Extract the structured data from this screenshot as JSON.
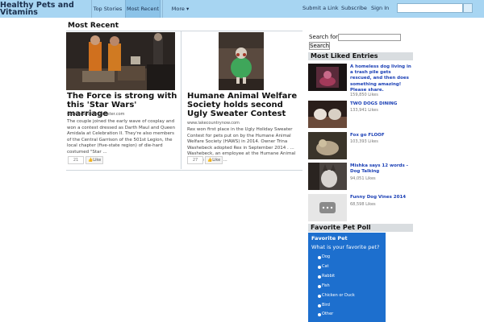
{
  "site": {
    "title_line1": "Healthy Pets and",
    "title_line2": "Vitamins"
  },
  "nav": {
    "items": [
      {
        "label": "Top Stories"
      },
      {
        "label": "Most Recent"
      },
      {
        "label": "More ▾"
      }
    ],
    "right_links": [
      "Submit a Link",
      "Subscribe",
      "Sign In"
    ]
  },
  "main": {
    "section_title": "Most Recent",
    "articles": [
      {
        "headline": "The Force is strong with this 'Star Wars' marriage",
        "source": "www.desmoinesregister.com",
        "excerpt": "The couple joined the early wave of cosplay and won a contest dressed as Darth Maul and Queen Amidala at Celebration II. They're also members of the Central Garrison of the 501st Legion, the local chapter (five-state region) of die-hard costumed \"Star ...",
        "count": "21",
        "like_label": "Like"
      },
      {
        "headline": "Humane Animal Welfare Society holds second Ugly Sweater Contest",
        "source": "www.lakecountrynow.com",
        "excerpt": "Rex won first place in the Ugly Holiday Sweater Contest for pets put on by the Humane Animal Welfare Society (HAWS) in 2014. Owner Trina Washebeck adopted Rex in September 2014 . ... Washebeck, an employee at the Humane Animal Welfare Society ...",
        "count": "27",
        "like_label": "Like"
      }
    ]
  },
  "sidebar": {
    "search_label": "Search for:",
    "search_button": "Search",
    "most_liked_title": "Most Liked Entries",
    "entries": [
      {
        "title": "A homeless dog living in a trash pile gets rescued, and then does something amazing! Please share.",
        "likes": "159,850 Likes"
      },
      {
        "title": "TWO DOGS DINING",
        "likes": "133,941 Likes"
      },
      {
        "title": "Fox go FLOOF",
        "likes": "103,393 Likes"
      },
      {
        "title": "Mishka says 12 words - Dog Talking",
        "likes": "94,051 Likes"
      },
      {
        "title": "Funny Dog Vines 2014",
        "likes": "68,598 Likes"
      }
    ],
    "poll": {
      "section_title": "Favorite Pet Poll",
      "title": "Favorite Pet",
      "question": "What is your favorite pet?",
      "options": [
        "Dog",
        "Cat",
        "Rabbit",
        "Fish",
        "Chicken or Duck",
        "Bird",
        "Other"
      ]
    }
  }
}
